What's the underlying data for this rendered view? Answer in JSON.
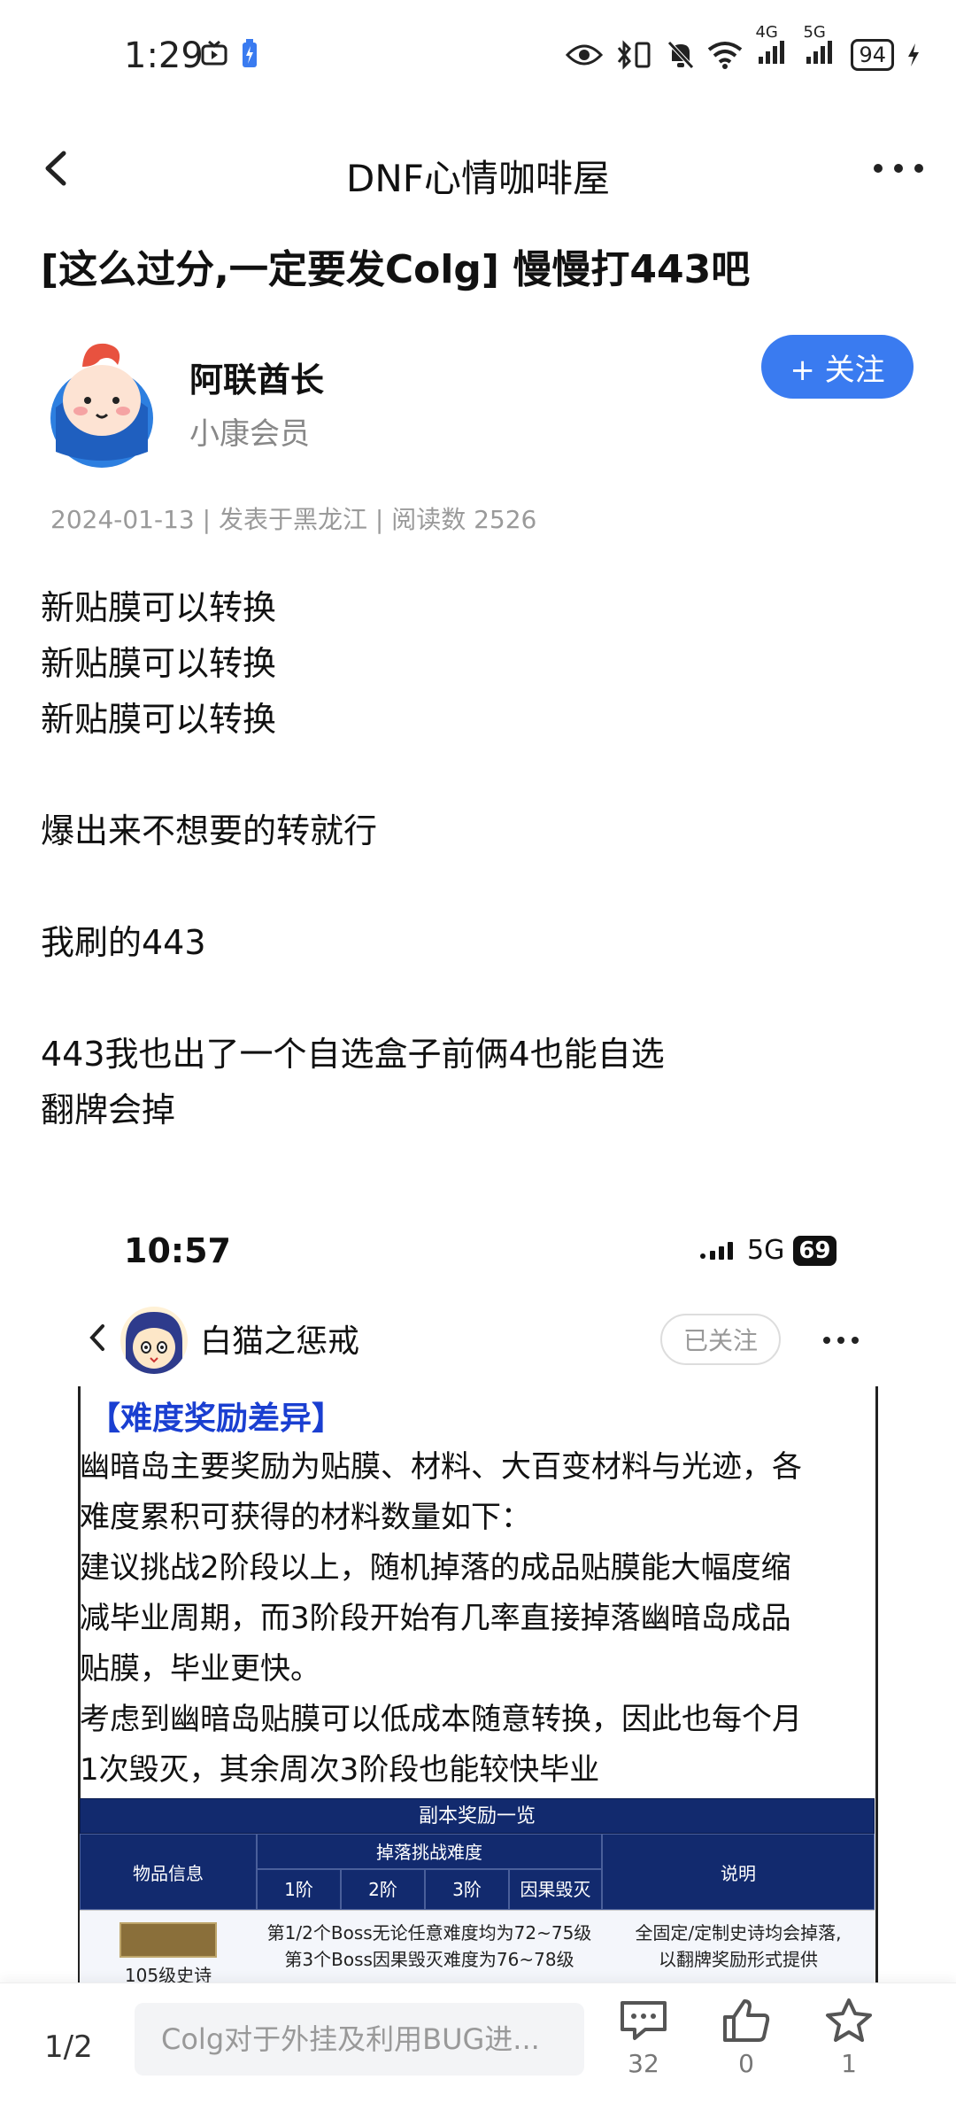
{
  "status_bar": {
    "time": "1:29",
    "network_4g": "4G",
    "network_5g": "5G",
    "battery": "94"
  },
  "nav": {
    "title": "DNF心情咖啡屋"
  },
  "post": {
    "title": "[这么过分,一定要发Colg] 慢慢打443吧",
    "author": {
      "name": "阿联酋长",
      "role": "小康会员"
    },
    "follow_label": "+ 关注",
    "meta": "2024-01-13 | 发表于黑龙江 | 阅读数 2526",
    "body_lines": [
      "新贴膜可以转换",
      "新贴膜可以转换",
      "新贴膜可以转换",
      "",
      "爆出来不想要的转就行",
      "",
      "我刷的443",
      "",
      "443我也出了一个自选盒子前俩4也能自选",
      "翻牌会掉"
    ]
  },
  "embedded": {
    "time": "10:57",
    "network": "5G",
    "battery": "69",
    "author": "白猫之惩戒",
    "follow_label": "已关注",
    "heading": "【难度奖励差异】",
    "paragraph_lines": [
      "幽暗岛主要奖励为贴膜、材料、大百变材料与光迹，各",
      "难度累积可获得的材料数量如下：",
      "建议挑战2阶段以上，随机掉落的成品贴膜能大幅度缩",
      "减毕业周期，而3阶段开始有几率直接掉落幽暗岛成品",
      "贴膜，毕业更快。",
      "考虑到幽暗岛贴膜可以低成本随意转换，因此也每个月",
      "1次毁灭，其余周次3阶段也能较快毕业"
    ],
    "table": {
      "title": "副本奖励一览",
      "col_item": "物品信息",
      "col_diff": "掉落挑战难度",
      "diff_levels": [
        "1阶",
        "2阶",
        "3阶",
        "因果毁灭"
      ],
      "col_note": "说明",
      "row1_item": "105级史诗",
      "row1_diff_line1": "第1/2个Boss无论任意难度均为72~75级",
      "row1_diff_line2": "第3个Boss因果毁灭难度为76~78级",
      "row1_note_line1": "全固定/定制史诗均会掉落,",
      "row1_note_line2": "以翻牌奖励形式提供"
    }
  },
  "bottom_bar": {
    "page_indicator": "1/2",
    "comment_placeholder": "Colg对于外挂及利用BUG进...",
    "comment_count": "32",
    "like_count": "0",
    "favorite_count": "1"
  },
  "colors": {
    "accent": "#3a7bf0",
    "embedded_heading": "#1a3fd1",
    "table_header": "#122a6e"
  }
}
